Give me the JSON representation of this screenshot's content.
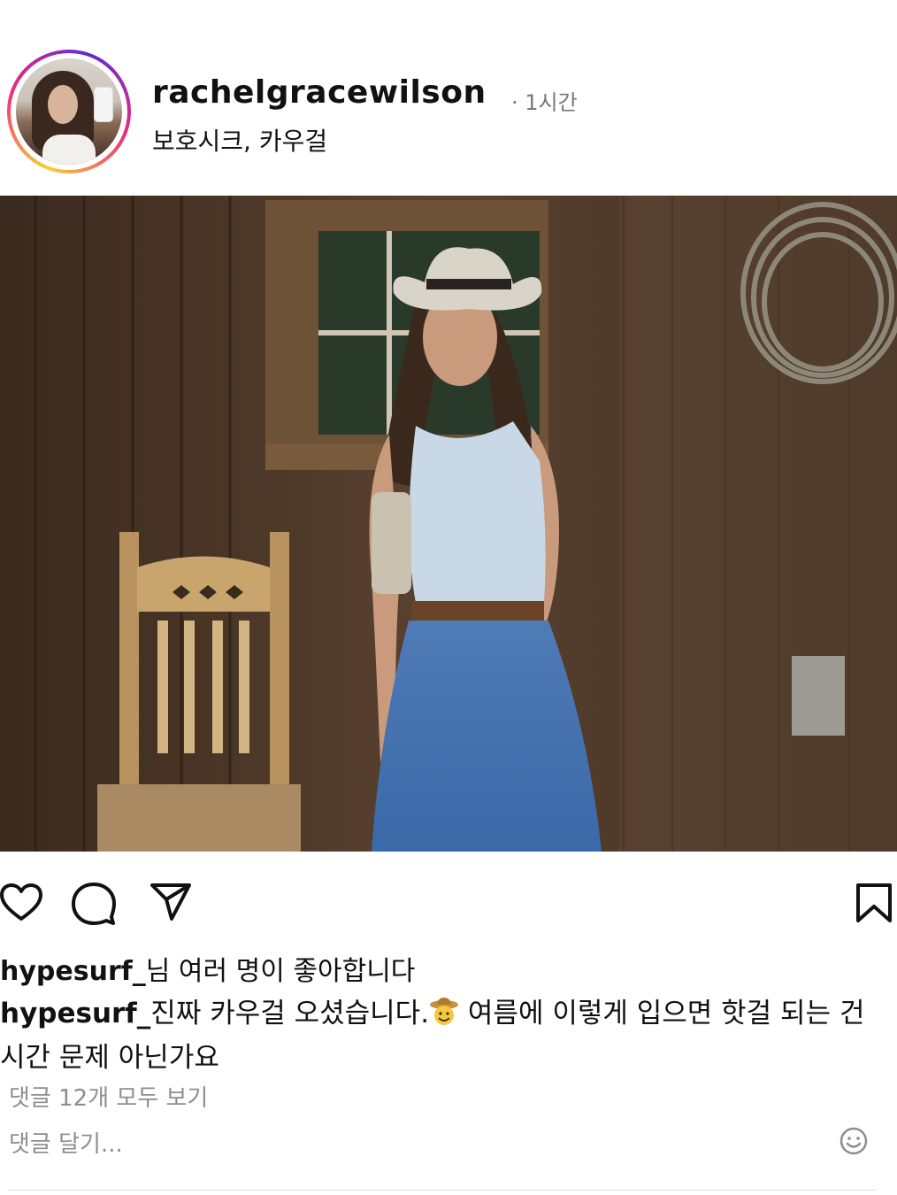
{
  "post": {
    "username": "rachelgracewilson",
    "time": "· 1시간",
    "location": "보호시크, 카우걸"
  },
  "actions": {
    "like_icon": "heart-outline-icon",
    "comment_icon": "speech-bubble-icon",
    "share_icon": "paper-plane-icon",
    "save_icon": "bookmark-icon"
  },
  "likes": {
    "user": "hypesurf_",
    "text": "님 여러 명이 좋아합니다"
  },
  "caption": {
    "user": "hypesurf_",
    "text_before_emoji": "진짜 카우걸 오셨습니다.",
    "emoji": "cowboy-face-emoji",
    "text_after_emoji": " 여름에 이렇게 입으면 핫걸 되는 건 시간 문제 아닌가요"
  },
  "comments": {
    "view_all": "댓글 12개 모두 보기",
    "add_placeholder": "댓글 달기...",
    "emoji_icon": "smiley-icon"
  }
}
